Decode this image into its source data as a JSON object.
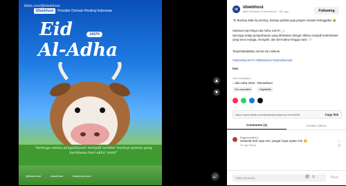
{
  "poster": {
    "top_text": "tiktok.com/@idwebhost",
    "brand": "IDwebhost",
    "brand_tag": "Provider Domain Hosting Indonesia",
    "title_line1": "Eid",
    "year_pill": "1447H",
    "title_line2": "Al-Adha",
    "quote": "\"Semoga setiap pengorbanan menjadi sumber backup pahala yang membawa hari akhir nanti\"",
    "footer": [
      "@idwebhost",
      "idwebhost",
      "idwebhost.com"
    ]
  },
  "nav": {
    "up_icon": "chevron-up-icon",
    "down_icon": "chevron-down-icon",
    "volume_icon": "volume-icon"
  },
  "panel": {
    "author": "idwebhost",
    "author_sub": "Bikin Website di IDwebhost · 16h ago",
    "follow_label": "Following",
    "caption_lines": [
      "🐄 Backup data itu penting, backup pahala juga jangan sampai ketinggalan 😄",
      "Selamat Hari Raya Idul Adha 1447H 🌙",
      "Semoga setiap pengorbanan yang dilakukan dengan ikhlas menjadi keberkahan yang terus terjaga, mengalir, dan bermakna hingga nanti. 🤍",
      "Tespehaladatkau minna wa minkum."
    ],
    "hashtags": "#IdulAdha1447H #IdWebHost #IdulAdhaAdat",
    "less_label": "less",
    "see_translation": "See translation",
    "music": "♪ Idul Adha 2026 - Ramadhani",
    "reported": [
      "You reposted",
      "Yegabkite"
    ],
    "link_url": "https://www.tiktok.com/@idwebhost/photo/7e443498...",
    "copy_link": "Copy link",
    "tabs": [
      "Comments (1)",
      "Creator videos"
    ],
    "comment": {
      "user": "Bagassantiho1",
      "text": "Selamat hari raya min, jangan lupa nyate min 😊",
      "meta": "4s ago   Reply",
      "likes": "0"
    },
    "add_comment_placeholder": "Add comment...",
    "post_label": "Post"
  },
  "colors": {
    "accent": "#fe2c55",
    "hashtag": "#2b5db9"
  }
}
